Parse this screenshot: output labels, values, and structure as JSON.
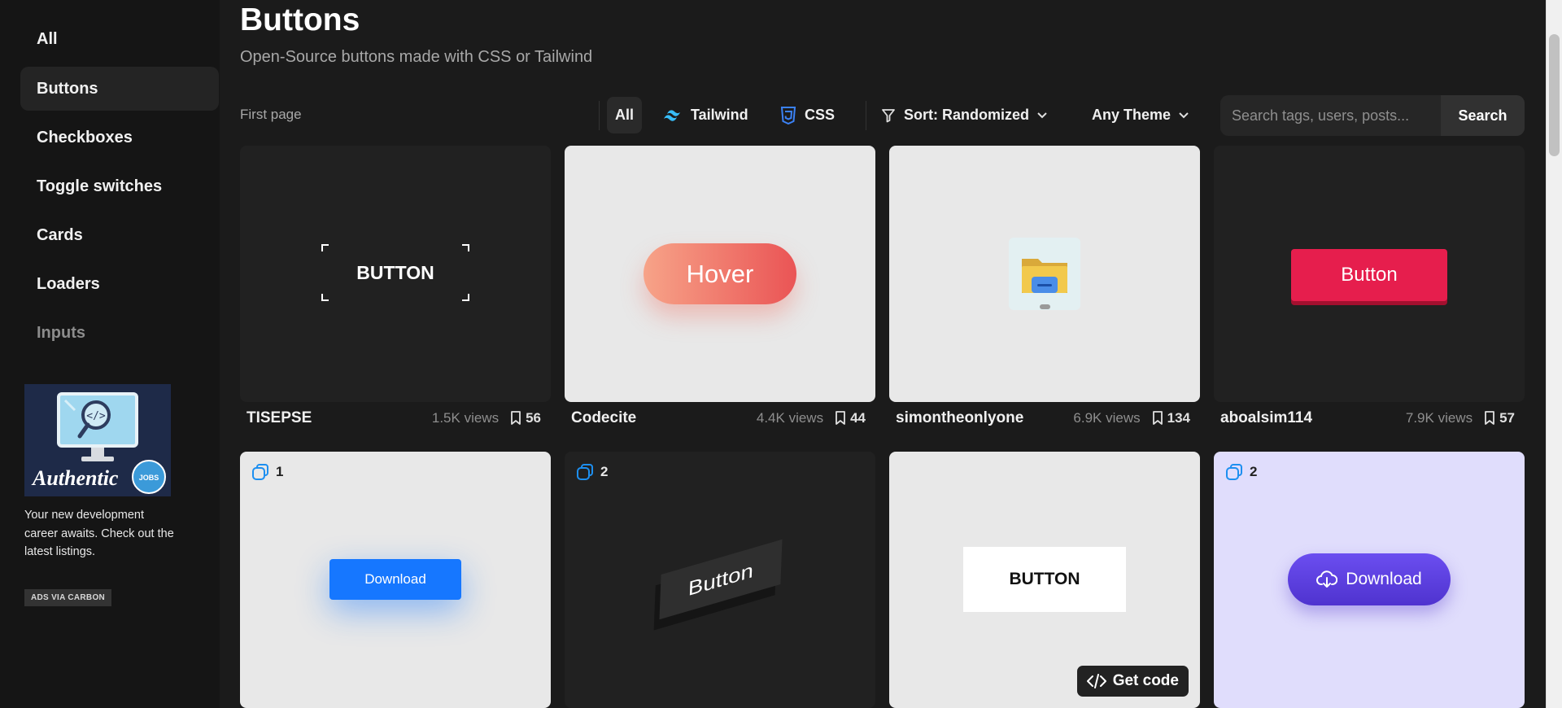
{
  "sidebar": {
    "items": [
      {
        "label": "All"
      },
      {
        "label": "Buttons"
      },
      {
        "label": "Checkboxes"
      },
      {
        "label": "Toggle switches"
      },
      {
        "label": "Cards"
      },
      {
        "label": "Loaders"
      },
      {
        "label": "Inputs"
      }
    ],
    "active_item": "Buttons",
    "ad": {
      "brand": "Authentic",
      "badge_word": "JOBS",
      "text": "Your new development career awaits. Check out the latest listings.",
      "badge": "ADS VIA CARBON"
    }
  },
  "header": {
    "title": "Buttons",
    "subtitle": "Open-Source buttons made with CSS or Tailwind"
  },
  "toolbar": {
    "first_page": "First page",
    "filters": {
      "all": "All",
      "tailwind": "Tailwind",
      "css": "CSS"
    },
    "sort": "Sort: Randomized",
    "theme": "Any Theme",
    "search_placeholder": "Search tags, users, posts...",
    "search_button": "Search"
  },
  "cards_row1": [
    {
      "author": "TISEPSE",
      "views": "1.5K views",
      "saves": "56",
      "preview_text": "BUTTON"
    },
    {
      "author": "Codecite",
      "views": "4.4K views",
      "saves": "44",
      "preview_text": "Hover"
    },
    {
      "author": "simontheonlyone",
      "views": "6.9K views",
      "saves": "134",
      "preview_text": ""
    },
    {
      "author": "aboalsim114",
      "views": "7.9K views",
      "saves": "57",
      "preview_text": "Button"
    }
  ],
  "cards_row2": [
    {
      "variants": "1",
      "preview_text": "Download"
    },
    {
      "variants": "2",
      "preview_text": "Button"
    },
    {
      "variants": "",
      "preview_text": "BUTTON",
      "get_code": "Get code"
    },
    {
      "variants": "2",
      "preview_text": "Download"
    }
  ],
  "colors": {
    "background": "#1b1b1b",
    "sidebar": "#151515",
    "card_dark": "#212121",
    "card_light": "#e8e8e8",
    "accent_blue": "#1677ff",
    "coral": "#f26b5b",
    "crimson": "#e11d48",
    "purple": "#5b3ee0"
  }
}
